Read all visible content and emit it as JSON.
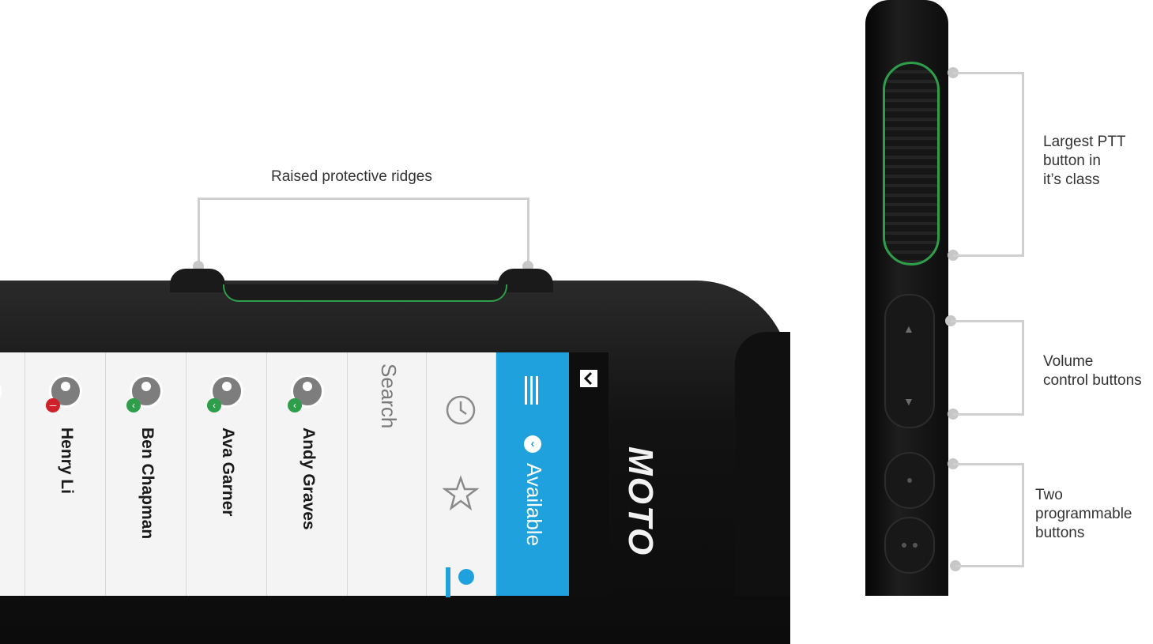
{
  "callouts": {
    "ridges": "Raised protective ridges",
    "ptt": [
      "Largest PTT",
      "button in",
      "it’s class"
    ],
    "volume": [
      "Volume",
      "control buttons"
    ],
    "programmable": [
      "Two",
      "programmable",
      "buttons"
    ]
  },
  "screen": {
    "contacts": [
      {
        "name": "Henry Li",
        "status": "busy"
      },
      {
        "name": "Ben Chapman",
        "status": "available"
      },
      {
        "name": "Ava Garner",
        "status": "available"
      },
      {
        "name": "Andy Graves",
        "status": "available"
      }
    ],
    "search_placeholder": "Search",
    "status_label": "Available",
    "icons": [
      "history-icon",
      "star-icon",
      "contacts-icon",
      "menu-icon"
    ]
  },
  "brand": {
    "logo_text": "MOTO"
  },
  "colors": {
    "accent_green": "#2e9e4a",
    "status_bar_blue": "#1ea1dd",
    "available_green": "#2e9e4a",
    "busy_red": "#d0202a",
    "leader_line": "#cfcfcf"
  }
}
